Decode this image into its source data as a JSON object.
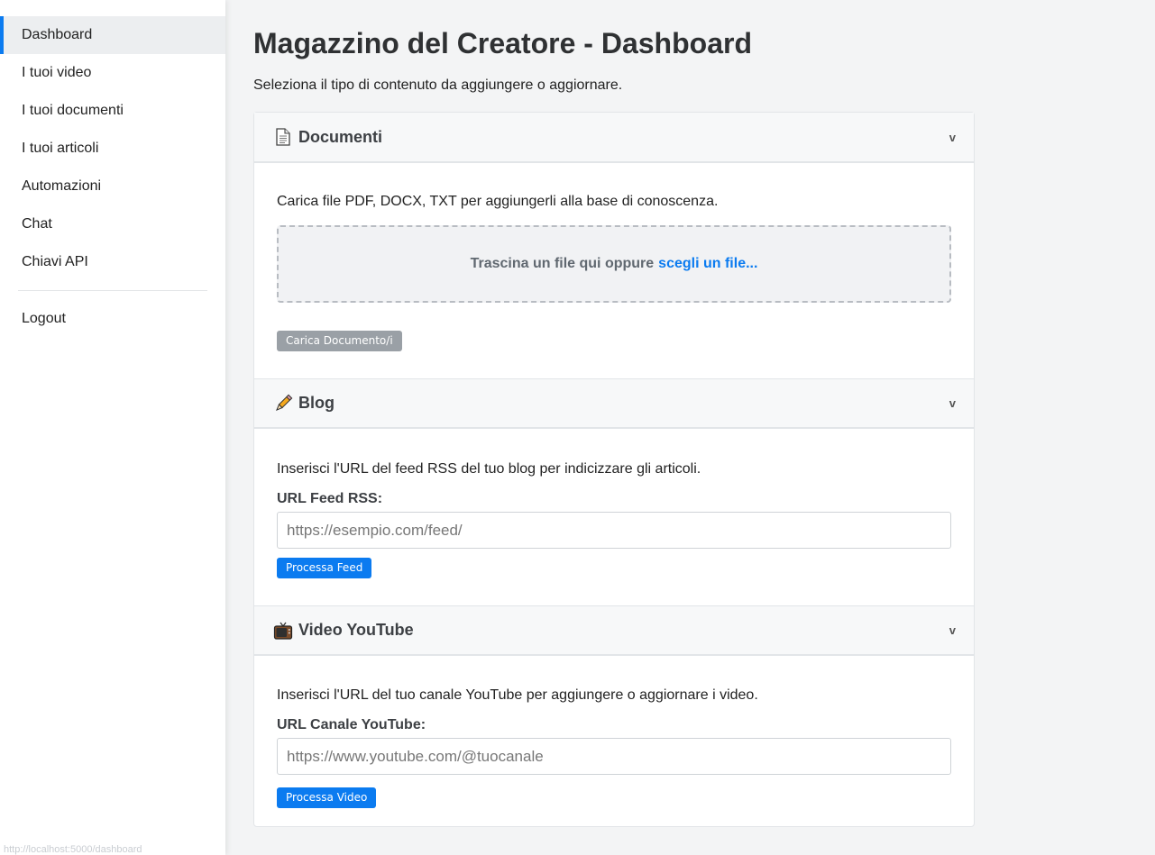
{
  "sidebar": {
    "items": [
      {
        "label": "Dashboard"
      },
      {
        "label": "I tuoi video"
      },
      {
        "label": "I tuoi documenti"
      },
      {
        "label": "I tuoi articoli"
      },
      {
        "label": "Automazioni"
      },
      {
        "label": "Chat"
      },
      {
        "label": "Chiavi API"
      }
    ],
    "logout": "Logout",
    "status_url": "http://localhost:5000/dashboard"
  },
  "page": {
    "title": "Magazzino del Creatore - Dashboard",
    "subtitle": "Seleziona il tipo di contenuto da aggiungere o aggiornare."
  },
  "sections": {
    "documents": {
      "icon": "document-icon",
      "title": "Documenti",
      "chevron": "v",
      "description": "Carica file PDF, DOCX, TXT per aggiungerli alla base di conoscenza.",
      "dropzone_text": "Trascina un file qui oppure",
      "dropzone_link": "scegli un file...",
      "button": "Carica Documento/i"
    },
    "blog": {
      "icon": "pencil-icon",
      "title": "Blog",
      "chevron": "v",
      "description": "Inserisci l'URL del feed RSS del tuo blog per indicizzare gli articoli.",
      "field_label": "URL Feed RSS:",
      "placeholder": "https://esempio.com/feed/",
      "button": "Processa Feed"
    },
    "youtube": {
      "icon": "television-icon",
      "title": "Video YouTube",
      "chevron": "v",
      "description": "Inserisci l'URL del tuo canale YouTube per aggiungere o aggiornare i video.",
      "field_label": "URL Canale YouTube:",
      "placeholder": "https://www.youtube.com/@tuocanale",
      "button": "Processa Video"
    }
  },
  "colors": {
    "accent": "#0b7bf0",
    "disabled_button": "#9aa0a6"
  }
}
